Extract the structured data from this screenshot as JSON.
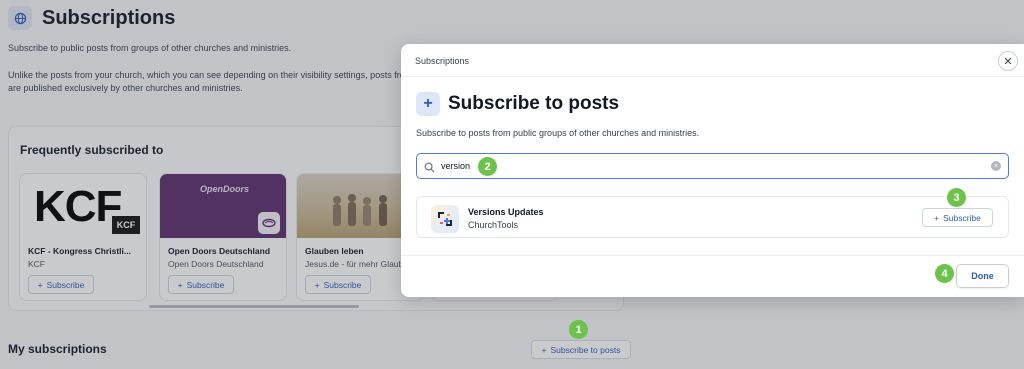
{
  "page": {
    "title": "Subscriptions",
    "subtitle": "Subscribe to public posts from groups of other churches and ministries.",
    "paragraph_line1": "Unlike the posts from your church, which you can see depending on their visibility settings, posts fro",
    "paragraph_line2": "are published exclusively by other churches and ministries.",
    "frequently_title": "Frequently subscribed to",
    "my_subscriptions_title": "My subscriptions",
    "subscribe_to_posts_label": "Subscribe to posts"
  },
  "cards": [
    {
      "name": "KCF - Kongress Christli...",
      "org": "KCF",
      "button": "Subscribe",
      "logo_text": "KCF",
      "logo_mini": "KCF"
    },
    {
      "name": "Open Doors Deutschland",
      "org": "Open Doors Deutschland",
      "button": "Subscribe",
      "logo_text": "OpenDoors"
    },
    {
      "name": "Glauben leben",
      "org": "Jesus.de - für mehr Glaub",
      "button": "Subscribe"
    }
  ],
  "modal": {
    "window_title": "Subscriptions",
    "close_glyph": "✕",
    "plus_glyph": "+",
    "heading": "Subscribe to posts",
    "subtitle": "Subscribe to posts from public groups of other churches and ministries.",
    "search_value": "version",
    "results": [
      {
        "title": "Versions Updates",
        "org": "ChurchTools",
        "button": "Subscribe"
      }
    ],
    "done_label": "Done"
  },
  "steps": [
    "1",
    "2",
    "3",
    "4"
  ],
  "colors": {
    "accent": "#2d5bb8",
    "step_marker": "#6cc24a",
    "focus_border": "#4d7cd6"
  }
}
